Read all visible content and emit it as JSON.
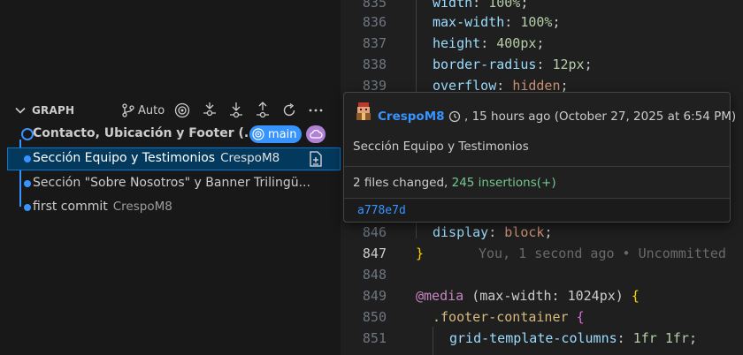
{
  "graph": {
    "title": "GRAPH",
    "toolbar": {
      "auto_label": "Auto"
    },
    "commits": [
      {
        "message": "Contacto, Ubicación y Footer (...",
        "author": "",
        "branch": "main"
      },
      {
        "message": "Sección Equipo y Testimonios",
        "author": "CrespoM8"
      },
      {
        "message": "Sección \"Sobre Nosotros\" y Banner Trilingü...",
        "author": ""
      },
      {
        "message": "first commit",
        "author": "CrespoM8"
      }
    ]
  },
  "hover": {
    "author": "CrespoM8",
    "relative_time": ", 15 hours ago (October 27, 2025 at 6:54 PM)",
    "message": "Sección Equipo y Testimonios",
    "files_changed": "2 files changed, ",
    "insertions": "245 insertions(+)",
    "sha": "a778e7d"
  },
  "editor": {
    "lines": [
      {
        "n": "835",
        "prop": "width",
        "val": "100%"
      },
      {
        "n": "836",
        "prop": "max-width",
        "val": "100%"
      },
      {
        "n": "837",
        "prop": "height",
        "val": "400px"
      },
      {
        "n": "838",
        "prop": "border-radius",
        "val": "12px"
      },
      {
        "n": "839",
        "prop": "overflow",
        "val": "hidden"
      },
      {
        "n": "846",
        "prop": "display",
        "val": "block"
      },
      {
        "n": "847",
        "text": "}",
        "ghost": "You, 1 second ago • Uncommitted"
      },
      {
        "n": "848",
        "text": ""
      },
      {
        "n": "849",
        "at": "@media",
        "cond": "(max-width: 1024px)"
      },
      {
        "n": "850",
        "selector": ".footer-container"
      },
      {
        "n": "851",
        "prop": "grid-template-columns",
        "val": "1fr 1fr"
      }
    ]
  },
  "colors": {
    "accent": "#3794ff",
    "selection": "#04395e",
    "insertions": "#73c991",
    "cloud_badge": "#b180d7"
  }
}
